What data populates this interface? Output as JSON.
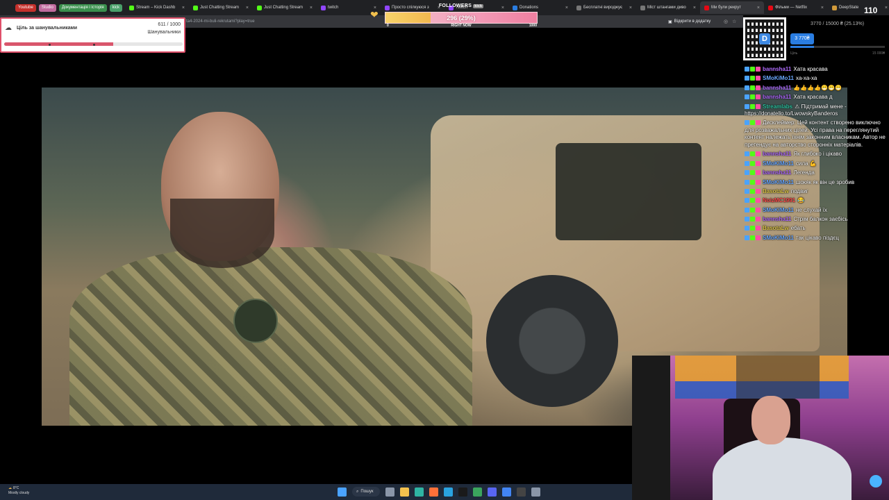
{
  "browser": {
    "bookmark_pills": [
      {
        "label": "Youtube",
        "color": "#c4302b"
      },
      {
        "label": "Studio",
        "color": "#c06b9e"
      },
      {
        "label": "Документація і історія",
        "color": "#3a8f4d"
      },
      {
        "label": "kick",
        "color": "#4aa06a"
      }
    ],
    "tabs": [
      {
        "label": "Stream – Kick Dashb",
        "icon_color": "#53fc18"
      },
      {
        "label": "Just Chatting Stream",
        "icon_color": "#53fc18"
      },
      {
        "label": "Just Chatting Stream",
        "icon_color": "#53fc18"
      },
      {
        "label": "twitch",
        "icon_color": "#9146ff"
      },
      {
        "label": "Просто спілкуюся з",
        "icon_color": "#9146ff"
      },
      {
        "label": "Twitch",
        "icon_color": "#9146ff"
      },
      {
        "label": "Donations",
        "icon_color": "#2a7de1"
      },
      {
        "label": "Бесплатні вироджує",
        "icon_color": "#777"
      },
      {
        "label": "Міст штангами диво",
        "icon_color": "#777"
      },
      {
        "label": "Ми були рекрут",
        "icon_color": "#e50914"
      },
      {
        "label": "Фільми — Netflix",
        "icon_color": "#e50914"
      },
      {
        "label": "DeepState",
        "icon_color": "#d19a3a"
      }
    ],
    "url": "ta4-2024-mi-buli-rekrutami?play=true",
    "open_in_app": "Відкрити в додатку"
  },
  "followers_widget": {
    "title": "FOLLOWERS",
    "badge": "kick",
    "value_text": "296 (29%)",
    "progress": 0.296,
    "min_label": "0",
    "max_label": "1000",
    "now_label": "RIGHT NOW"
  },
  "goal_widget": {
    "title": "Ціль за шанувальниками",
    "count": "611 / 1000",
    "subtitle": "Шанувальники",
    "progress": 0.611,
    "accent": "#d9566c"
  },
  "donation": {
    "progress_text": "3770 / 15000 ₴ (25.13%)",
    "amount": "3 770₴",
    "progress": 0.2513,
    "label": "Ціль",
    "goal": "15 000₴"
  },
  "viewer_count": "110",
  "chat": [
    {
      "user": "bannsha11",
      "color": "#b06cff",
      "text": "Хата красава"
    },
    {
      "user": "SMoKiMo11",
      "color": "#6aa8ff",
      "text": "ха-ха-ха"
    },
    {
      "user": "bannsha11",
      "color": "#b06cff",
      "text": "👍👍👍👍😁😁😁"
    },
    {
      "user": "bannsha11",
      "color": "#b06cff",
      "text": "Хата красава д"
    },
    {
      "user": "Streamlabs",
      "color": "#31c3a2",
      "text": "⚠ Підтримай мене - https://donatello.to/LwowskyBanderos"
    },
    {
      "user": "",
      "color": "#ff5a5a",
      "text": "Дисклеймер: Цей контент створено виключно для розважальних цілей. Усі права на переглянутий контент належать їхнім законним власникам. Автор не претендує на авторство сторонніх матеріалів."
    },
    {
      "user": "bannsha11",
      "color": "#b06cff",
      "text": "Як глибоко і цікаво"
    },
    {
      "user": "SMoKiMo11",
      "color": "#6aa8ff",
      "text": "сила 💪"
    },
    {
      "user": "bannsha11",
      "color": "#b06cff",
      "text": "Легенда"
    },
    {
      "user": "SMoKiMo11",
      "color": "#6aa8ff",
      "text": "шокяк як він це зробив"
    },
    {
      "user": "BasotaLw",
      "color": "#e0c94c",
      "text": "подвиг"
    },
    {
      "user": "NoizMC1991",
      "color": "#ff4d4d",
      "text": "😂"
    },
    {
      "user": "SMoKiMo11",
      "color": "#6aa8ff",
      "text": "не слухай їх"
    },
    {
      "user": "bannsha11",
      "color": "#b06cff",
      "text": "Стрім балкон заєбісь"
    },
    {
      "user": "BasotaLw",
      "color": "#e0c94c",
      "text": "ебать"
    },
    {
      "user": "SMoKiMo11",
      "color": "#6aa8ff",
      "text": "так цікаво піздєц"
    }
  ],
  "taskbar": {
    "temp": "8°C",
    "weather": "Mostly cloudy",
    "search": "Пошук",
    "apps": [
      {
        "name": "windows-icon",
        "color": "#4aa3ff"
      },
      {
        "name": "task-view-icon",
        "color": "#8a96a8"
      },
      {
        "name": "explorer-icon",
        "color": "#f2c14e"
      },
      {
        "name": "edge-icon",
        "color": "#2fb5a3"
      },
      {
        "name": "firefox-icon",
        "color": "#ff7139"
      },
      {
        "name": "telegram-icon",
        "color": "#2aa3e0"
      },
      {
        "name": "kick-icon",
        "color": "#1a1a1a"
      },
      {
        "name": "app-icon",
        "color": "#3ba55d"
      },
      {
        "name": "discord-icon",
        "color": "#5865f2"
      },
      {
        "name": "chrome-icon",
        "color": "#4285f4"
      },
      {
        "name": "obs-icon",
        "color": "#444"
      },
      {
        "name": "settings-icon",
        "color": "#8a96a8"
      }
    ]
  }
}
